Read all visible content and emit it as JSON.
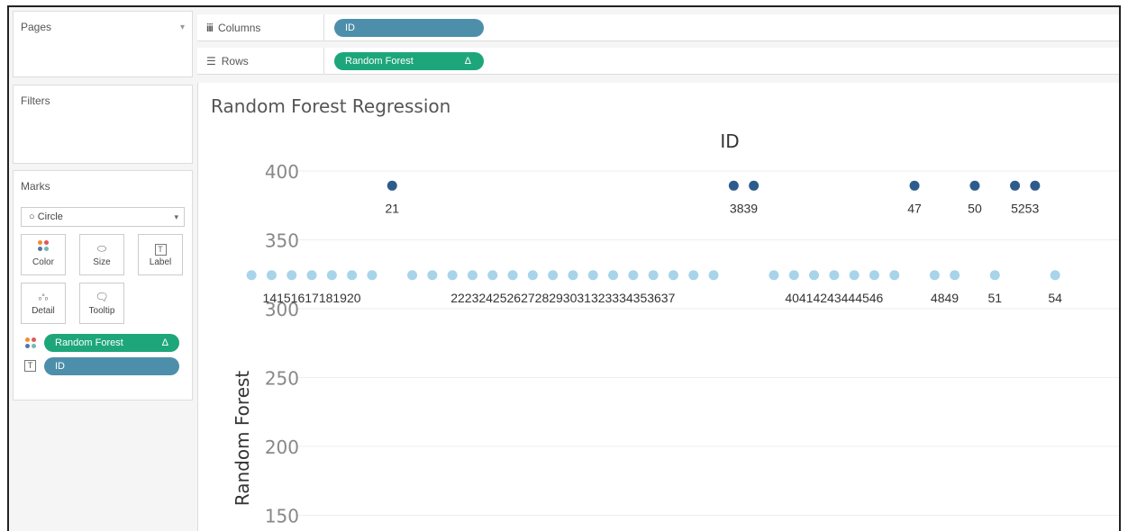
{
  "pages": {
    "label": "Pages"
  },
  "filters": {
    "label": "Filters"
  },
  "marks": {
    "label": "Marks",
    "mark_type": "Circle",
    "buttons": [
      {
        "label": "Color",
        "icon": "color-icon"
      },
      {
        "label": "Size",
        "icon": "size-icon"
      },
      {
        "label": "Label",
        "icon": "label-icon"
      },
      {
        "label": "Detail",
        "icon": "detail-icon"
      },
      {
        "label": "Tooltip",
        "icon": "tooltip-icon"
      }
    ],
    "pills": [
      {
        "label": "Random Forest",
        "suffix": "Δ",
        "color": "#1da67a",
        "icon": "color-dots-icon"
      },
      {
        "label": "ID",
        "color": "#4d8fab",
        "icon": "text-label-icon"
      }
    ]
  },
  "shelves": {
    "columns": {
      "label": "Columns",
      "pill": "ID",
      "icon": "columns-icon",
      "pill_color": "#4d8fab"
    },
    "rows": {
      "label": "Rows",
      "pill": "Random Forest",
      "suffix": "Δ",
      "icon": "rows-icon",
      "pill_color": "#1da67a"
    }
  },
  "view": {
    "title": "Random Forest Regression"
  },
  "chart_data": {
    "type": "scatter",
    "top_axis_label": "ID",
    "ylabel": "Random Forest",
    "yticks": [
      400,
      350,
      300,
      250,
      200,
      150
    ],
    "ylim": [
      150,
      400
    ],
    "grid": true,
    "colors": {
      "high": "#2d5b8c",
      "low": "#a8d4ea"
    },
    "series": [
      {
        "x": [
          21,
          38,
          39,
          47,
          50,
          52,
          53
        ],
        "y": 390,
        "color_key": "high"
      },
      {
        "x": [
          14,
          15,
          16,
          17,
          18,
          19,
          20,
          22,
          23,
          24,
          25,
          26,
          27,
          28,
          29,
          30,
          31,
          32,
          33,
          34,
          35,
          36,
          37,
          40,
          41,
          42,
          43,
          44,
          45,
          46,
          48,
          49,
          51,
          54
        ],
        "y": 325,
        "color_key": "low"
      }
    ],
    "labels_high": [
      "21",
      "3839",
      "47",
      "50",
      "5253"
    ],
    "labels_low": [
      "14151617181920",
      "22232425262728293031323334353637",
      "40414243444546",
      "4849",
      "51",
      "54"
    ]
  }
}
